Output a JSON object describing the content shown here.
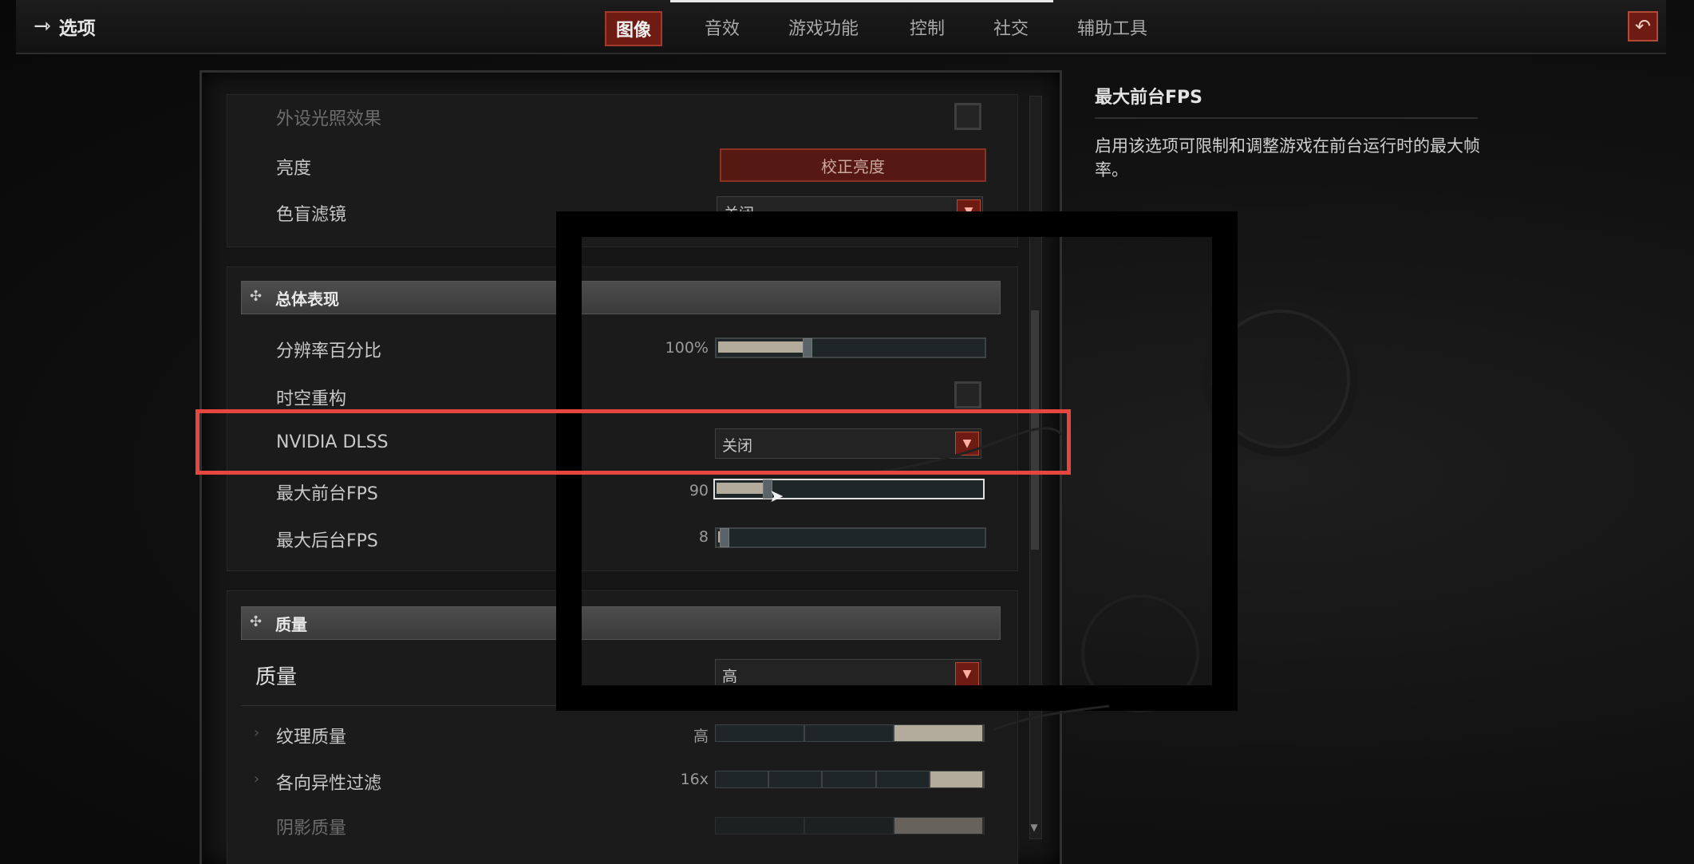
{
  "header": {
    "back_label": "选项",
    "tabs": [
      "图像",
      "音效",
      "游戏功能",
      "控制",
      "社交",
      "辅助工具"
    ],
    "active_tab": "图像"
  },
  "display": {
    "peripheral_lighting_label": "外设光照效果",
    "brightness_label": "亮度",
    "brightness_button": "校正亮度",
    "colorblind_label": "色盲滤镜",
    "colorblind_value": "关闭"
  },
  "performance": {
    "header": "总体表现",
    "resolution_label": "分辨率百分比",
    "resolution_value": "100%",
    "resolution_level": 0.33,
    "temporal_label": "时空重构",
    "dlss_label": "NVIDIA DLSS",
    "dlss_value": "关闭",
    "max_fg_fps_label": "最大前台FPS",
    "max_fg_fps_value": "90",
    "max_bg_fps_label": "最大后台FPS",
    "max_bg_fps_value": "8"
  },
  "quality": {
    "header": "质量",
    "quality_label": "质量",
    "quality_value": "高",
    "texture_label": "纹理质量",
    "texture_value": "高",
    "anisotropic_label": "各向异性过滤",
    "anisotropic_value": "16x",
    "shadow_label": "阴影质量"
  },
  "description": {
    "title": "最大前台FPS",
    "body": "启用该选项可限制和调整游戏在前台运行时的最大帧率。"
  },
  "colors": {
    "accent_red": "#6d1b13",
    "highlight_box": "#e5463f"
  }
}
